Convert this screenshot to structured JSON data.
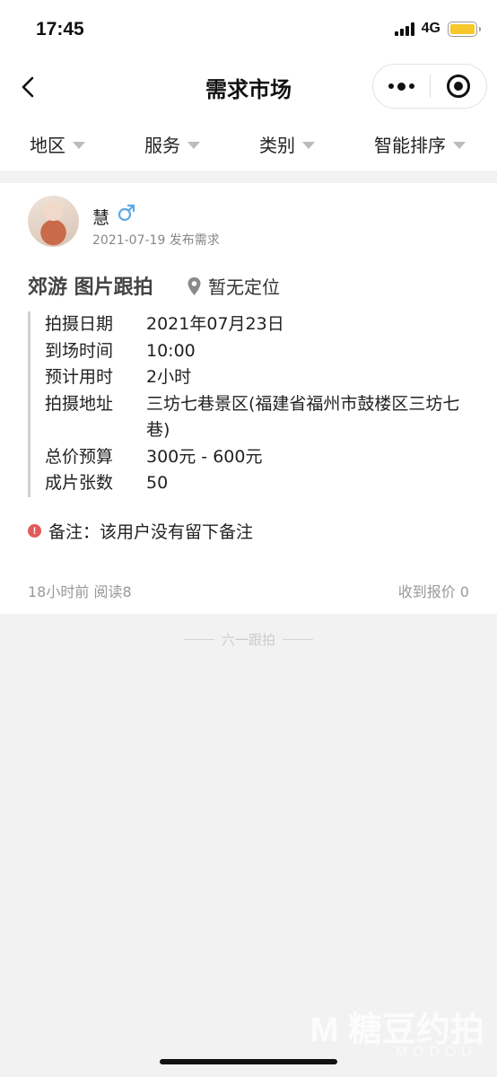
{
  "status_bar": {
    "time": "17:45",
    "network": "4G"
  },
  "nav": {
    "title": "需求市场"
  },
  "filters": [
    "地区",
    "服务",
    "类别",
    "智能排序"
  ],
  "card": {
    "user_name": "慧",
    "post_meta": "2021-07-19 发布需求",
    "title": "郊游 图片跟拍",
    "location": "暂无定位",
    "details": [
      {
        "label": "拍摄日期",
        "value": "2021年07月23日"
      },
      {
        "label": "到场时间",
        "value": "10:00"
      },
      {
        "label": "预计用时",
        "value": "2小时"
      },
      {
        "label": "拍摄地址",
        "value": "三坊七巷景区(福建省福州市鼓楼区三坊七巷)"
      },
      {
        "label": "总价预算",
        "value": "300元 - 600元"
      },
      {
        "label": "成片张数",
        "value": "50"
      }
    ],
    "remark": "备注：该用户没有留下备注",
    "footer_left": "18小时前 阅读8",
    "footer_right": "收到报价 0"
  },
  "footer_brand": "六一跟拍",
  "watermark": {
    "main": "M 糖豆约拍",
    "sub": "MODOU"
  },
  "colors": {
    "battery": "#f6c82a",
    "male": "#5aa9e6",
    "alert": "#e25b5b"
  }
}
